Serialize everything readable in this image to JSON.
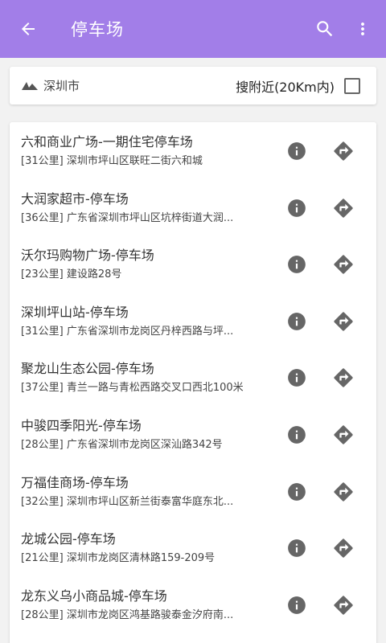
{
  "appbar": {
    "title": "停车场",
    "back_icon": "arrow-back-icon",
    "search_icon": "search-icon",
    "more_icon": "more-vert-icon",
    "color": "#a27ee8"
  },
  "filter": {
    "city": "深圳市",
    "city_icon": "landscape-icon",
    "nearby_label": "搜附近(20Km内)",
    "nearby_checked": false
  },
  "list": [
    {
      "name": "六和商业广场-一期住宅停车场",
      "address": "[31公里] 深圳市坪山区联旺二街六和城"
    },
    {
      "name": "大润家超市-停车场",
      "address": "[36公里] 广东省深圳市坪山区坑梓街道大润..."
    },
    {
      "name": "沃尔玛购物广场-停车场",
      "address": "[23公里] 建设路28号"
    },
    {
      "name": "深圳坪山站-停车场",
      "address": "[31公里] 广东省深圳市龙岗区丹梓西路与坪..."
    },
    {
      "name": "聚龙山生态公园-停车场",
      "address": "[37公里] 青兰一路与青松西路交叉口西北100米"
    },
    {
      "name": "中骏四季阳光-停车场",
      "address": "[28公里] 广东省深圳市龙岗区深汕路342号"
    },
    {
      "name": "万福佳商场-停车场",
      "address": "[32公里] 深圳市坪山区新兰街泰富华庭东北..."
    },
    {
      "name": "龙城公园-停车场",
      "address": "[21公里] 深圳市龙岗区清林路159-209号"
    },
    {
      "name": "龙东义乌小商品城-停车场",
      "address": "[28公里] 深圳市龙岗区鸿基路骏泰金汐府南..."
    }
  ],
  "row_icons": {
    "info": "info-icon",
    "navigate": "directions-icon"
  },
  "icon_color": "#666666"
}
